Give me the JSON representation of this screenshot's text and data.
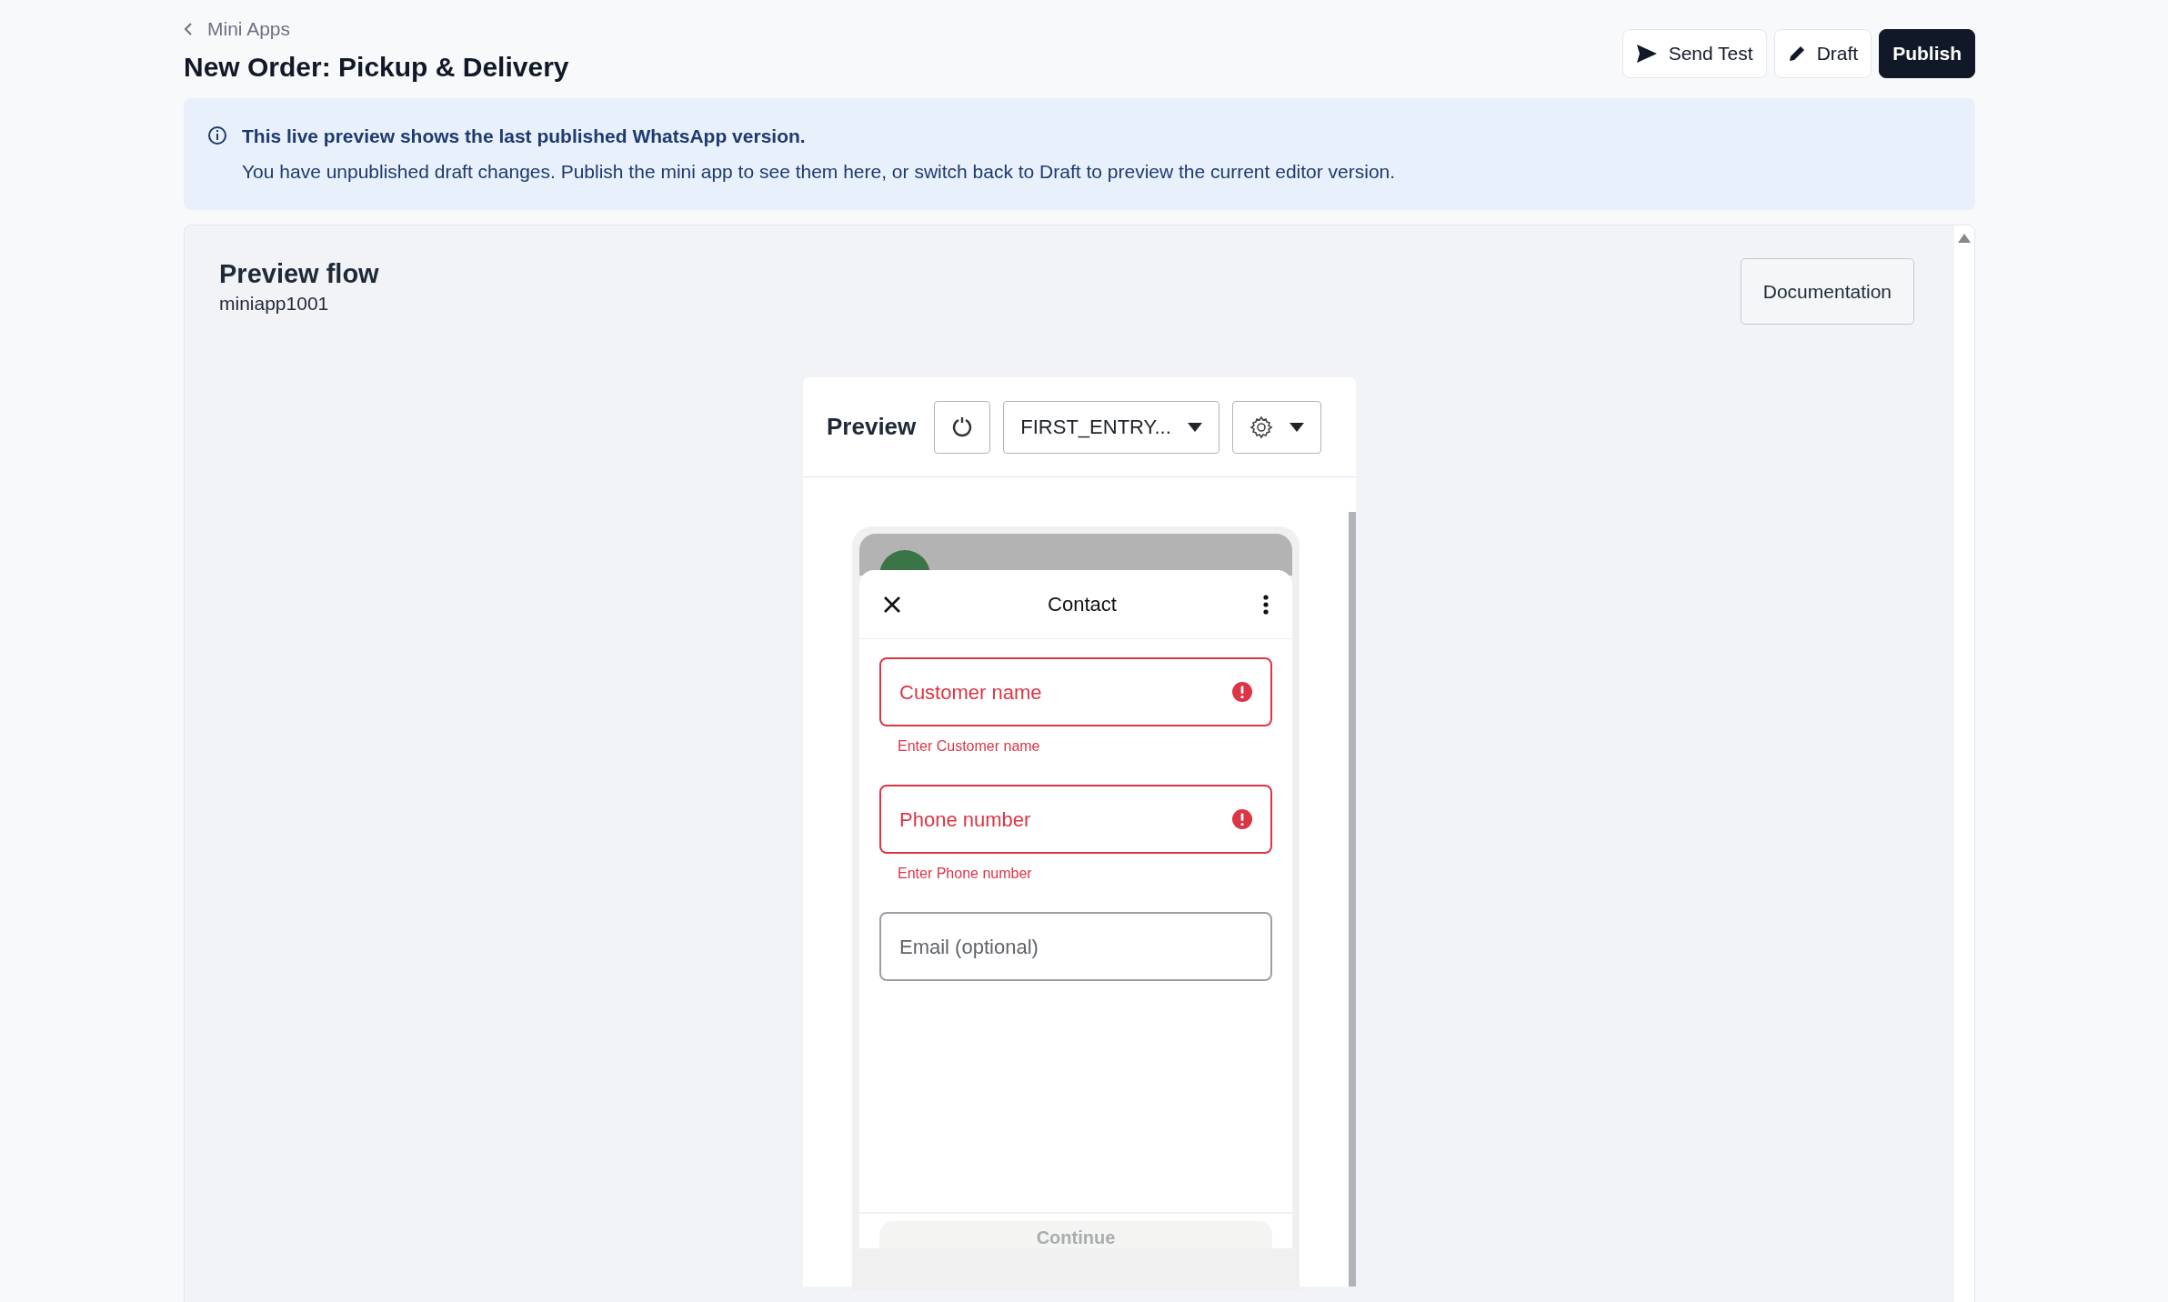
{
  "breadcrumb": {
    "label": "Mini Apps"
  },
  "title": "New Order: Pickup & Delivery",
  "actions": [
    {
      "label": "Send Test",
      "kind": "send",
      "primary": false
    },
    {
      "label": "Draft",
      "kind": "edit",
      "primary": false
    },
    {
      "label": "Publish",
      "kind": "plain",
      "primary": true
    }
  ],
  "alert": {
    "heading": "This live preview shows the last published WhatsApp version.",
    "message": "You have unpublished draft changes. Publish the mini app to see them here, or switch back to Draft to preview the current editor version."
  },
  "panel": {
    "title": "Preview flow",
    "subtitle": "miniapp1001",
    "button": "Documentation"
  },
  "preview": {
    "title": "Preview",
    "screen_select": "FIRST_ENTRY...",
    "phone": {
      "title": "Contact",
      "fields": [
        {
          "placeholder": "Customer name",
          "error": true,
          "error_text": "Enter Customer name"
        },
        {
          "placeholder": "Phone number",
          "error": true,
          "error_text": "Enter Phone number"
        },
        {
          "placeholder": "Email (optional)",
          "error": false
        }
      ],
      "footer_button": {
        "label": "Continue",
        "disabled": true
      }
    }
  }
}
